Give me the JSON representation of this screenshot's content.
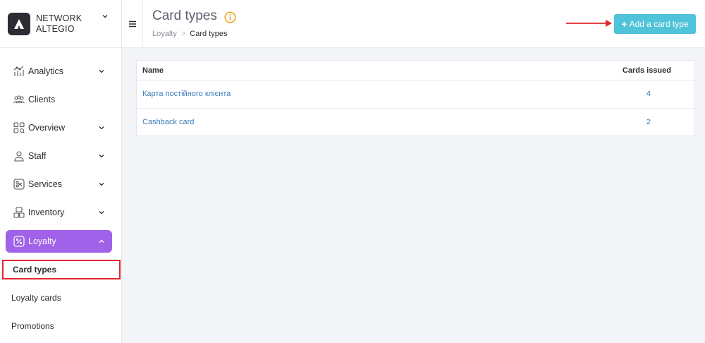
{
  "brand": {
    "line1": "NETWORK",
    "line2": "ALTEGIO",
    "logo_icon": "altegio-logo-icon"
  },
  "sidebar": {
    "items": [
      {
        "label": "Analytics",
        "icon": "analytics-icon",
        "expandable": true
      },
      {
        "label": "Clients",
        "icon": "clients-icon",
        "expandable": false
      },
      {
        "label": "Overview",
        "icon": "overview-icon",
        "expandable": true
      },
      {
        "label": "Staff",
        "icon": "staff-icon",
        "expandable": true
      },
      {
        "label": "Services",
        "icon": "services-icon",
        "expandable": true
      },
      {
        "label": "Inventory",
        "icon": "inventory-icon",
        "expandable": true
      },
      {
        "label": "Loyalty",
        "icon": "loyalty-icon",
        "expandable": true,
        "active": true
      }
    ],
    "loyalty_sub": [
      {
        "label": "Card types",
        "current": true
      },
      {
        "label": "Loyalty cards"
      },
      {
        "label": "Promotions"
      }
    ],
    "active_color": "#a062e8"
  },
  "header": {
    "title": "Card types",
    "breadcrumb": {
      "parent": "Loyalty",
      "separator": ">",
      "current": "Card types"
    },
    "add_button": "Add a card type",
    "add_button_color": "#4fc3d9"
  },
  "table": {
    "columns": [
      "Name",
      "Cards issued"
    ],
    "rows": [
      {
        "name": "Карта постійного клієнта",
        "issued": "4"
      },
      {
        "name": "Cashback card",
        "issued": "2"
      }
    ]
  },
  "annotation_color": "#e0262e"
}
